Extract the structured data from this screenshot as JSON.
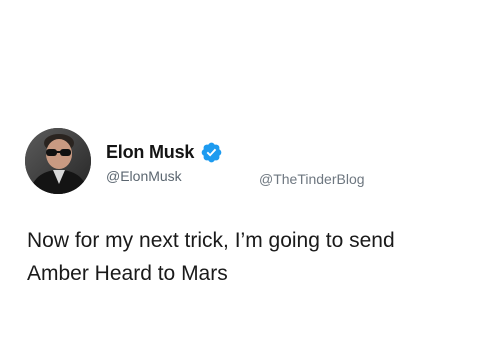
{
  "tweet": {
    "author": {
      "display_name": "Elon Musk",
      "handle": "@ElonMusk",
      "verified": true,
      "verified_badge_color": "#1d9bf0"
    },
    "watermark": "@TheTinderBlog",
    "text_line_1": "Now for my next trick, I’m going to send",
    "text_line_2": "Amber Heard to Mars"
  },
  "icons": {
    "avatar": "avatar-icon",
    "verified": "verified-badge-icon"
  }
}
